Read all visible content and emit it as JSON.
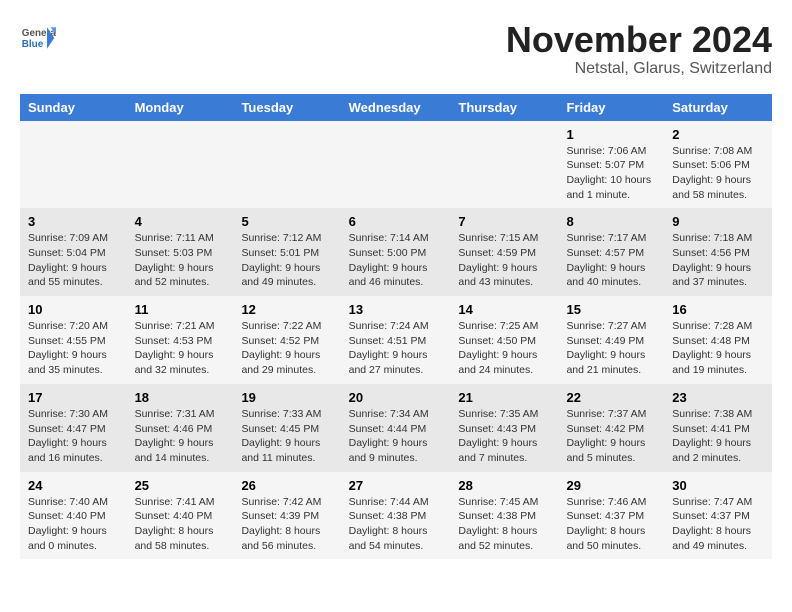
{
  "header": {
    "logo_general": "General",
    "logo_blue": "Blue",
    "month_title": "November 2024",
    "location": "Netstal, Glarus, Switzerland"
  },
  "columns": [
    "Sunday",
    "Monday",
    "Tuesday",
    "Wednesday",
    "Thursday",
    "Friday",
    "Saturday"
  ],
  "weeks": [
    {
      "days": [
        {
          "num": "",
          "info": ""
        },
        {
          "num": "",
          "info": ""
        },
        {
          "num": "",
          "info": ""
        },
        {
          "num": "",
          "info": ""
        },
        {
          "num": "",
          "info": ""
        },
        {
          "num": "1",
          "info": "Sunrise: 7:06 AM\nSunset: 5:07 PM\nDaylight: 10 hours and 1 minute."
        },
        {
          "num": "2",
          "info": "Sunrise: 7:08 AM\nSunset: 5:06 PM\nDaylight: 9 hours and 58 minutes."
        }
      ]
    },
    {
      "days": [
        {
          "num": "3",
          "info": "Sunrise: 7:09 AM\nSunset: 5:04 PM\nDaylight: 9 hours and 55 minutes."
        },
        {
          "num": "4",
          "info": "Sunrise: 7:11 AM\nSunset: 5:03 PM\nDaylight: 9 hours and 52 minutes."
        },
        {
          "num": "5",
          "info": "Sunrise: 7:12 AM\nSunset: 5:01 PM\nDaylight: 9 hours and 49 minutes."
        },
        {
          "num": "6",
          "info": "Sunrise: 7:14 AM\nSunset: 5:00 PM\nDaylight: 9 hours and 46 minutes."
        },
        {
          "num": "7",
          "info": "Sunrise: 7:15 AM\nSunset: 4:59 PM\nDaylight: 9 hours and 43 minutes."
        },
        {
          "num": "8",
          "info": "Sunrise: 7:17 AM\nSunset: 4:57 PM\nDaylight: 9 hours and 40 minutes."
        },
        {
          "num": "9",
          "info": "Sunrise: 7:18 AM\nSunset: 4:56 PM\nDaylight: 9 hours and 37 minutes."
        }
      ]
    },
    {
      "days": [
        {
          "num": "10",
          "info": "Sunrise: 7:20 AM\nSunset: 4:55 PM\nDaylight: 9 hours and 35 minutes."
        },
        {
          "num": "11",
          "info": "Sunrise: 7:21 AM\nSunset: 4:53 PM\nDaylight: 9 hours and 32 minutes."
        },
        {
          "num": "12",
          "info": "Sunrise: 7:22 AM\nSunset: 4:52 PM\nDaylight: 9 hours and 29 minutes."
        },
        {
          "num": "13",
          "info": "Sunrise: 7:24 AM\nSunset: 4:51 PM\nDaylight: 9 hours and 27 minutes."
        },
        {
          "num": "14",
          "info": "Sunrise: 7:25 AM\nSunset: 4:50 PM\nDaylight: 9 hours and 24 minutes."
        },
        {
          "num": "15",
          "info": "Sunrise: 7:27 AM\nSunset: 4:49 PM\nDaylight: 9 hours and 21 minutes."
        },
        {
          "num": "16",
          "info": "Sunrise: 7:28 AM\nSunset: 4:48 PM\nDaylight: 9 hours and 19 minutes."
        }
      ]
    },
    {
      "days": [
        {
          "num": "17",
          "info": "Sunrise: 7:30 AM\nSunset: 4:47 PM\nDaylight: 9 hours and 16 minutes."
        },
        {
          "num": "18",
          "info": "Sunrise: 7:31 AM\nSunset: 4:46 PM\nDaylight: 9 hours and 14 minutes."
        },
        {
          "num": "19",
          "info": "Sunrise: 7:33 AM\nSunset: 4:45 PM\nDaylight: 9 hours and 11 minutes."
        },
        {
          "num": "20",
          "info": "Sunrise: 7:34 AM\nSunset: 4:44 PM\nDaylight: 9 hours and 9 minutes."
        },
        {
          "num": "21",
          "info": "Sunrise: 7:35 AM\nSunset: 4:43 PM\nDaylight: 9 hours and 7 minutes."
        },
        {
          "num": "22",
          "info": "Sunrise: 7:37 AM\nSunset: 4:42 PM\nDaylight: 9 hours and 5 minutes."
        },
        {
          "num": "23",
          "info": "Sunrise: 7:38 AM\nSunset: 4:41 PM\nDaylight: 9 hours and 2 minutes."
        }
      ]
    },
    {
      "days": [
        {
          "num": "24",
          "info": "Sunrise: 7:40 AM\nSunset: 4:40 PM\nDaylight: 9 hours and 0 minutes."
        },
        {
          "num": "25",
          "info": "Sunrise: 7:41 AM\nSunset: 4:40 PM\nDaylight: 8 hours and 58 minutes."
        },
        {
          "num": "26",
          "info": "Sunrise: 7:42 AM\nSunset: 4:39 PM\nDaylight: 8 hours and 56 minutes."
        },
        {
          "num": "27",
          "info": "Sunrise: 7:44 AM\nSunset: 4:38 PM\nDaylight: 8 hours and 54 minutes."
        },
        {
          "num": "28",
          "info": "Sunrise: 7:45 AM\nSunset: 4:38 PM\nDaylight: 8 hours and 52 minutes."
        },
        {
          "num": "29",
          "info": "Sunrise: 7:46 AM\nSunset: 4:37 PM\nDaylight: 8 hours and 50 minutes."
        },
        {
          "num": "30",
          "info": "Sunrise: 7:47 AM\nSunset: 4:37 PM\nDaylight: 8 hours and 49 minutes."
        }
      ]
    }
  ]
}
